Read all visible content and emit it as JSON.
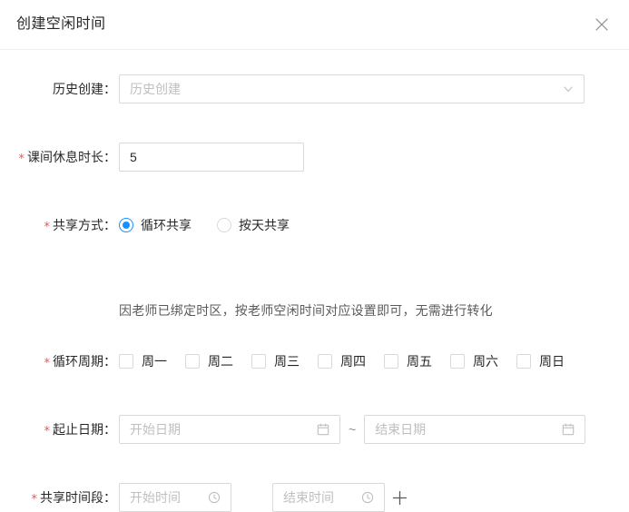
{
  "modal": {
    "title": "创建空闲时间",
    "close_icon": "close-icon"
  },
  "form": {
    "history": {
      "label": "历史创建：",
      "required": false,
      "placeholder": "历史创建",
      "value": "",
      "suffix_icon": "chevron-down-icon"
    },
    "break_duration": {
      "label": "课间休息时长：",
      "required": true,
      "required_mark": "*",
      "value": "5",
      "placeholder": ""
    },
    "share_mode": {
      "label": "共享方式：",
      "required": true,
      "required_mark": "*",
      "selected": "循环共享",
      "options": [
        {
          "label": "循环共享",
          "checked": true
        },
        {
          "label": "按天共享",
          "checked": false
        }
      ]
    },
    "hint": {
      "text": "因老师已绑定时区，按老师空闲时间对应设置即可，无需进行转化"
    },
    "cycle": {
      "label": "循环周期：",
      "required": true,
      "required_mark": "*",
      "days": [
        {
          "label": "周一",
          "checked": false
        },
        {
          "label": "周二",
          "checked": false
        },
        {
          "label": "周三",
          "checked": false
        },
        {
          "label": "周四",
          "checked": false
        },
        {
          "label": "周五",
          "checked": false
        },
        {
          "label": "周六",
          "checked": false
        },
        {
          "label": "周日",
          "checked": false
        }
      ]
    },
    "date_range": {
      "label": "起止日期：",
      "required": true,
      "required_mark": "*",
      "separator": "~",
      "start": {
        "placeholder": "开始日期",
        "value": "",
        "suffix_icon": "calendar-icon"
      },
      "end": {
        "placeholder": "结束日期",
        "value": "",
        "suffix_icon": "calendar-icon"
      }
    },
    "time_range": {
      "label": "共享时间段：",
      "required": true,
      "required_mark": "*",
      "start": {
        "placeholder": "开始时间",
        "value": "",
        "suffix_icon": "clock-icon"
      },
      "end": {
        "placeholder": "结束时间",
        "value": "",
        "suffix_icon": "clock-icon"
      },
      "add_icon": "plus-icon"
    }
  },
  "colors": {
    "accent": "#1890ff",
    "required": "#ff4d4f",
    "border": "#d9d9d9",
    "placeholder": "#bfbfbf",
    "text": "rgba(0,0,0,0.85)"
  }
}
